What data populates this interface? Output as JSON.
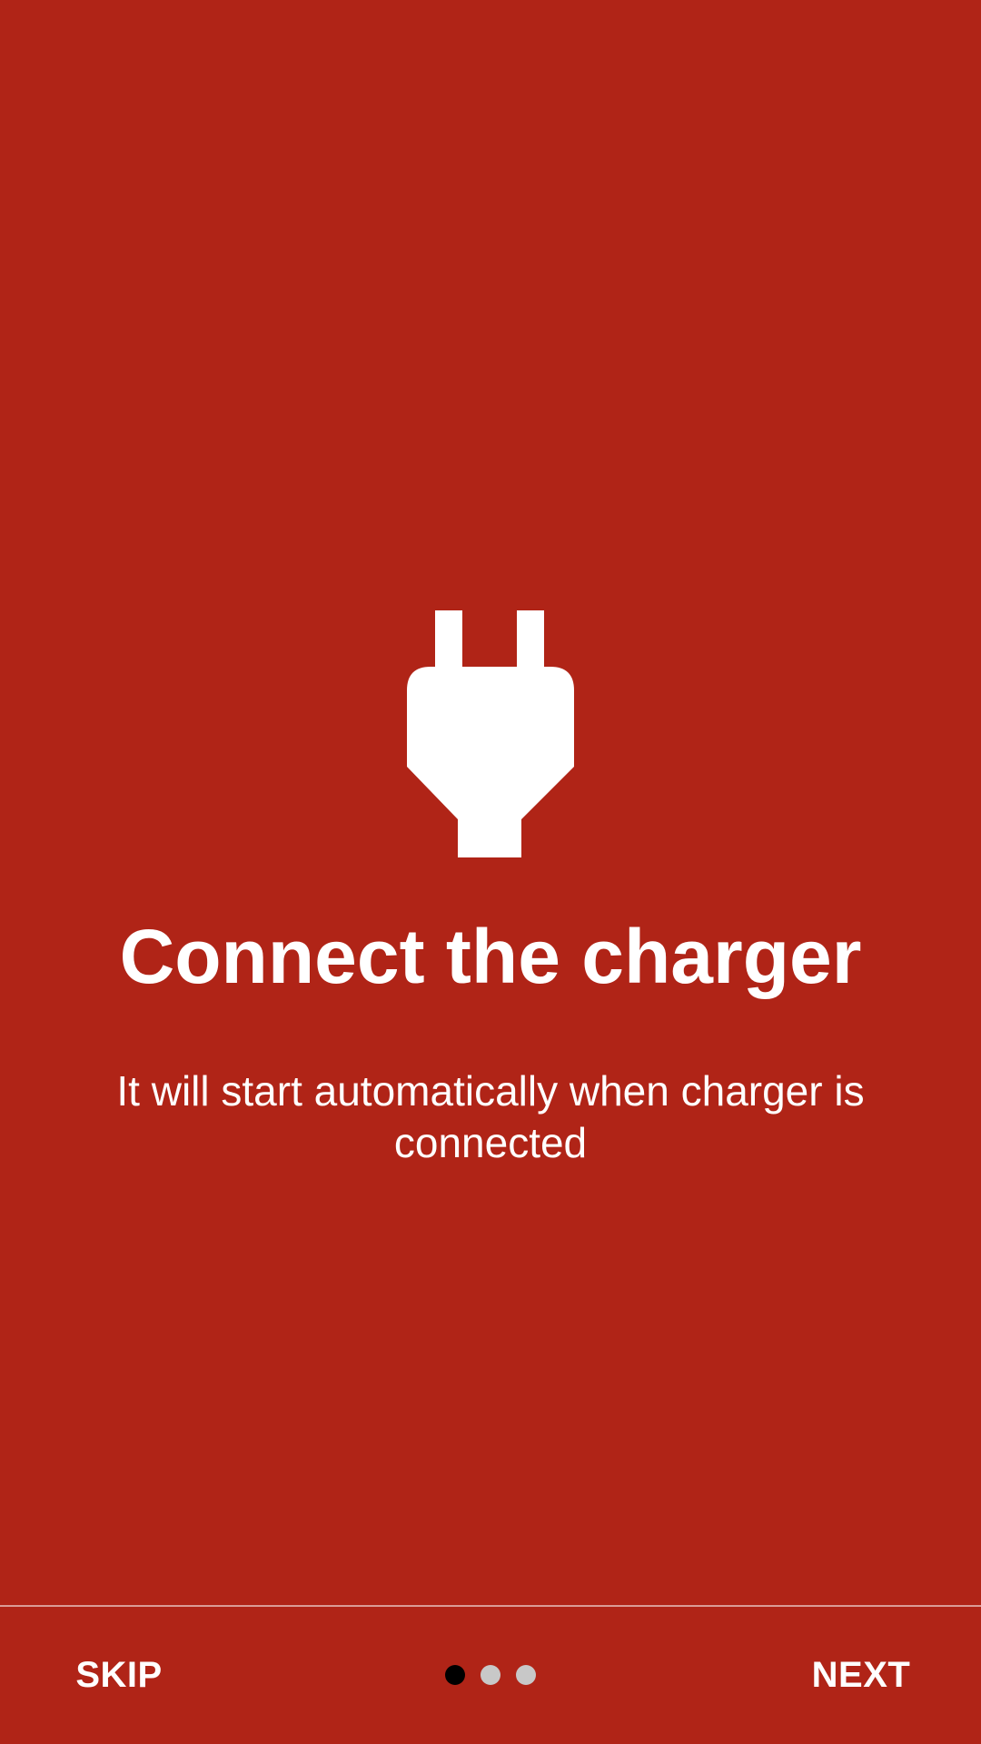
{
  "colors": {
    "background": "#B02417",
    "text": "#FFFFFF",
    "dot_active": "#000000",
    "dot_inactive": "#C8C8C8"
  },
  "onboarding": {
    "icon": "power-plug-icon",
    "title": "Connect the charger",
    "subtitle": "It will start automatically when charger is connected"
  },
  "footer": {
    "skip_label": "SKIP",
    "next_label": "NEXT",
    "page_indicator": {
      "total": 3,
      "current": 1
    }
  }
}
